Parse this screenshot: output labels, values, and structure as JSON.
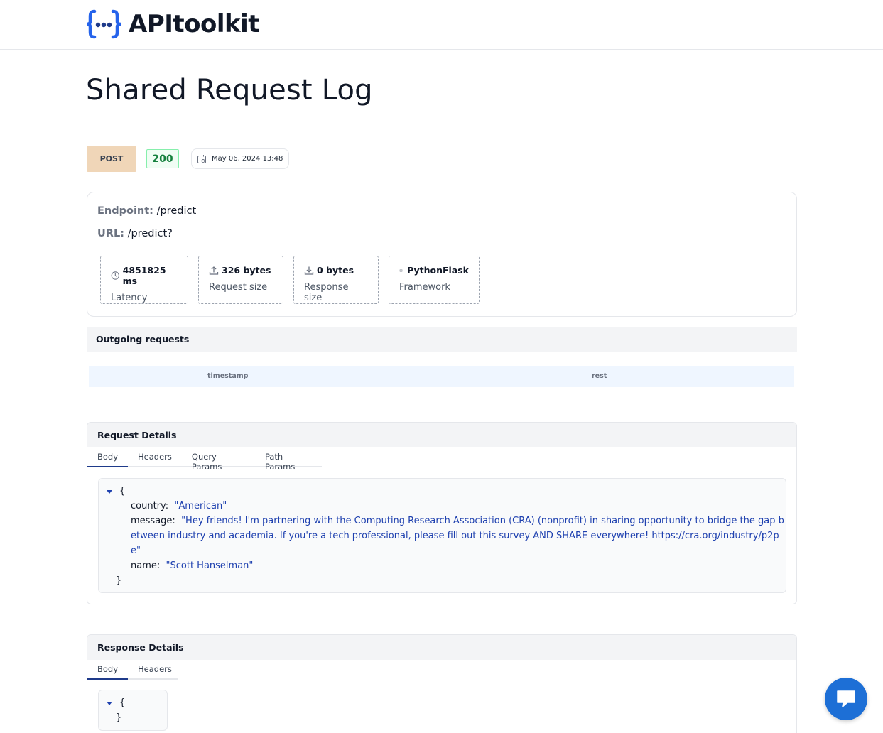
{
  "app": {
    "brand": "APItoolkit",
    "brand_color": "#2563eb"
  },
  "page": {
    "title": "Shared Request Log"
  },
  "request_meta": {
    "method": "POST",
    "status": "200",
    "timestamp": "May 06, 2024 13:48"
  },
  "summary": {
    "endpoint_label": "Endpoint:",
    "endpoint_value": "/predict",
    "url_label": "URL:",
    "url_value": "/predict?",
    "stats": [
      {
        "icon": "clock-icon",
        "value": "4851825 ms",
        "label": "Latency"
      },
      {
        "icon": "upload-icon",
        "value": "326 bytes",
        "label": "Request size"
      },
      {
        "icon": "download-icon",
        "value": "0 bytes",
        "label": "Response size"
      },
      {
        "icon": "layers-icon",
        "value": "PythonFlask",
        "label": "Framework"
      }
    ]
  },
  "outgoing": {
    "title": "Outgoing requests",
    "columns": [
      "timestamp",
      "rest"
    ]
  },
  "request_details": {
    "title": "Request Details",
    "tabs": [
      "Body",
      "Headers",
      "Query Params",
      "Path Params"
    ],
    "active_tab": "Body",
    "body": {
      "open_brace": "{",
      "close_brace": "}",
      "fields": [
        {
          "key": "country:",
          "value": "\"American\""
        },
        {
          "key": "message:",
          "value_lines": [
            "\"Hey friends! I'm partnering with the Computing Research Association (CRA) (nonprofit) in sharing opportunity to bridge the gap b",
            "etween industry and academia. If you're a tech professional, please fill out this survey AND SHARE everywhere! https://cra.org/industry/p2p",
            "e\""
          ]
        },
        {
          "key": "name:",
          "value": "\"Scott Hanselman\""
        }
      ]
    }
  },
  "response_details": {
    "title": "Response Details",
    "tabs": [
      "Body",
      "Headers"
    ],
    "active_tab": "Body",
    "body": {
      "open_brace": "{",
      "close_brace": "}"
    }
  },
  "chat": {
    "icon": "chat-bubble-icon",
    "color": "#1d6fd6"
  }
}
